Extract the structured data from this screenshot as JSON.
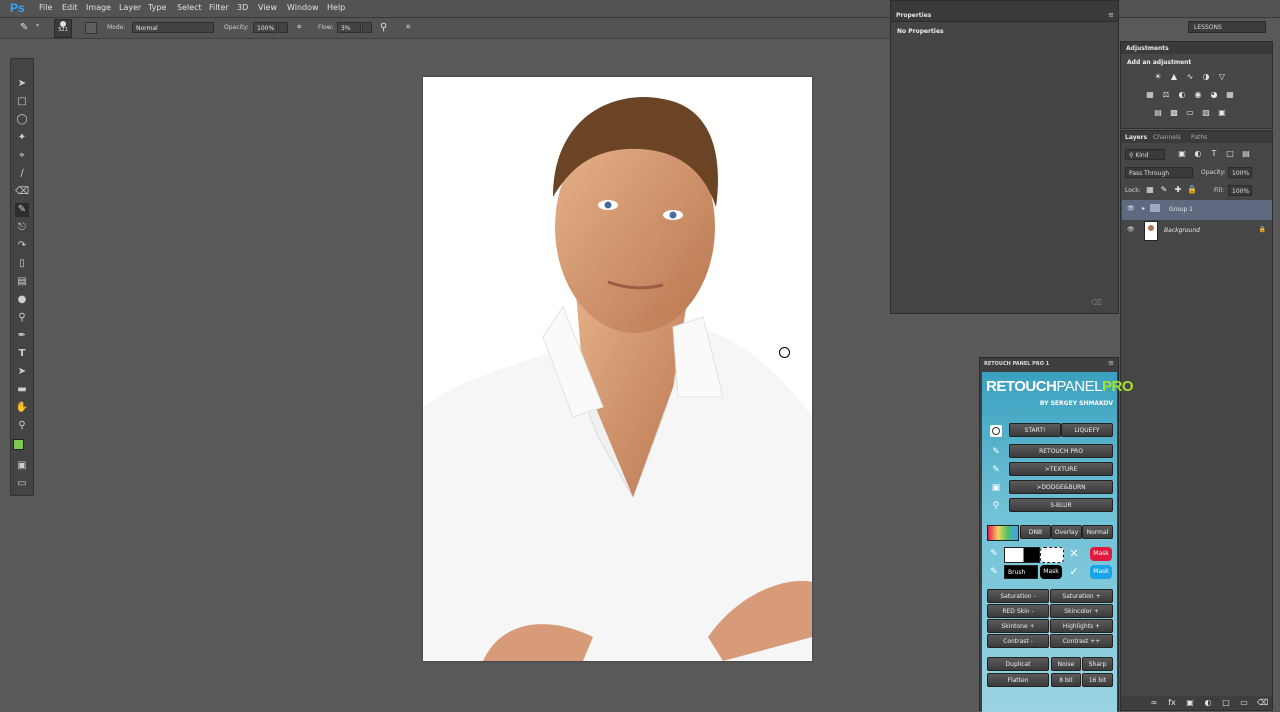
{
  "app": {
    "logo": "Ps"
  },
  "menu": [
    "File",
    "Edit",
    "Image",
    "Layer",
    "Type",
    "Select",
    "Filter",
    "3D",
    "View",
    "Window",
    "Help"
  ],
  "options_bar": {
    "brush_size": "521",
    "mode_label": "Mode:",
    "mode_value": "Normal",
    "opacity_label": "Opacity:",
    "opacity_value": "100%",
    "flow_label": "Flow:",
    "flow_value": "3%"
  },
  "workspace": {
    "name": "LESSONS"
  },
  "properties_panel": {
    "title": "Properties",
    "empty_text": "No Properties"
  },
  "adjustments_panel": {
    "title": "Adjustments",
    "subtitle": "Add an adjustment"
  },
  "layers_panel": {
    "tabs": [
      "Layers",
      "Channels",
      "Paths"
    ],
    "filter_kind": "Kind",
    "blend_mode": "Pass Through",
    "opacity_label": "Opacity:",
    "opacity_value": "100%",
    "lock_label": "Lock:",
    "fill_label": "Fill:",
    "fill_value": "100%",
    "layers": [
      {
        "name": "Group 1",
        "type": "group"
      },
      {
        "name": "Background",
        "type": "image"
      }
    ]
  },
  "retouch_panel": {
    "title": "RETOUCH PANEL PRO 1",
    "brand_retouch": "RETOUCH",
    "brand_panel": "PANEL",
    "brand_pro": "PRO",
    "byline": "BY SERGEY SHMAKOV",
    "buttons": {
      "start": "START!",
      "liquify": "LIQUEFY",
      "retouch_pro": "RETOUCH PRO",
      "texture": ">TEXTURE",
      "dodge_burn": ">DODGE&BURN",
      "s_blur": "S-BLUR",
      "dnb": "DNB",
      "overlay": "Overlay",
      "normal": "Normal",
      "brush": "Brush",
      "mask": "Mask",
      "mask_red": "Mask",
      "mask_blue": "Mask",
      "saturation_minus": "Saturation -",
      "saturation_plus": "Saturation +",
      "red_skin_minus": "RED Skin -",
      "skincolor_plus": "Skincolor +",
      "skintone_plus": "Skintone +",
      "highlights_plus": "Highlights +",
      "contrast_minus": "Contrast -",
      "contrast_plus": "Contrast ++",
      "duplicat": "Duplicat",
      "noise": "Noise",
      "sharp": "Sharp",
      "flatten": "Flatten",
      "bit8": "8 bit",
      "bit16": "16 bit"
    }
  }
}
